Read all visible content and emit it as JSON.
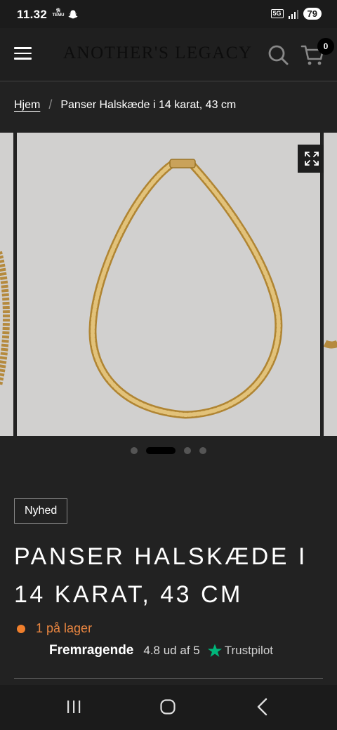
{
  "status_bar": {
    "time": "11.32",
    "temu_line1": "快",
    "temu_line2": "TEMU",
    "network": "5G",
    "battery": "79"
  },
  "header": {
    "logo": "ANOTHER'S LEGACY",
    "cart_count": "0"
  },
  "breadcrumb": {
    "home": "Hjem",
    "separator": "/",
    "current": "Panser Halskæde i 14 karat, 43 cm"
  },
  "gallery": {
    "slide_count": 4,
    "active_index": 1,
    "image_background": "#d1d0cf"
  },
  "product": {
    "badge": "Nyhed",
    "title": "PANSER HALSKÆDE I 14 KARAT, 43 CM",
    "stock": "1 på lager",
    "stock_color": "#f07f2c"
  },
  "trustpilot": {
    "label": "Fremragende",
    "score": "4.8 ud af 5",
    "brand": "Trustpilot",
    "star_color": "#00b67a"
  }
}
